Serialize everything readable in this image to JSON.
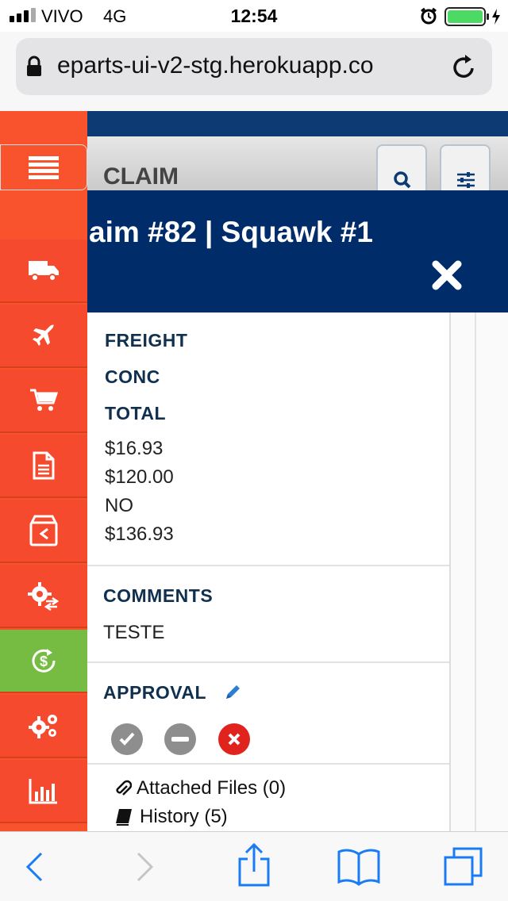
{
  "status_bar": {
    "carrier": "VIVO",
    "network": "4G",
    "time": "12:54"
  },
  "browser": {
    "url": "eparts-ui-v2-stg.herokuapp.co"
  },
  "page": {
    "section_title": "CLAIM"
  },
  "modal": {
    "title": "aim #82 | Squawk #1",
    "labels": {
      "freight": "FREIGHT",
      "conc": "CONC",
      "total": "TOTAL"
    },
    "values": [
      "$16.93",
      "$120.00",
      "NO",
      "$136.93"
    ],
    "comments_label": "COMMENTS",
    "comments_value": "TESTE",
    "approval_label": "APPROVAL",
    "attached_files": "Attached Files (0)",
    "history": "History (5)"
  },
  "sidebar": {
    "items": [
      "menu-icon",
      "truck-icon",
      "plane-icon",
      "cart-icon",
      "document-icon",
      "return-box-icon",
      "gear-exchange-icon",
      "dollar-refresh-icon",
      "gears-icon",
      "bar-chart-icon"
    ],
    "active_index": 7
  },
  "colors": {
    "sidebar": "#f9532e",
    "sidebar_active": "#76bc43",
    "modal_header": "#002d6a",
    "approve": "#8e8e8e",
    "reject": "#e1231d",
    "pencil": "#2d7fd3",
    "ios_blue": "#1a7cf5"
  }
}
